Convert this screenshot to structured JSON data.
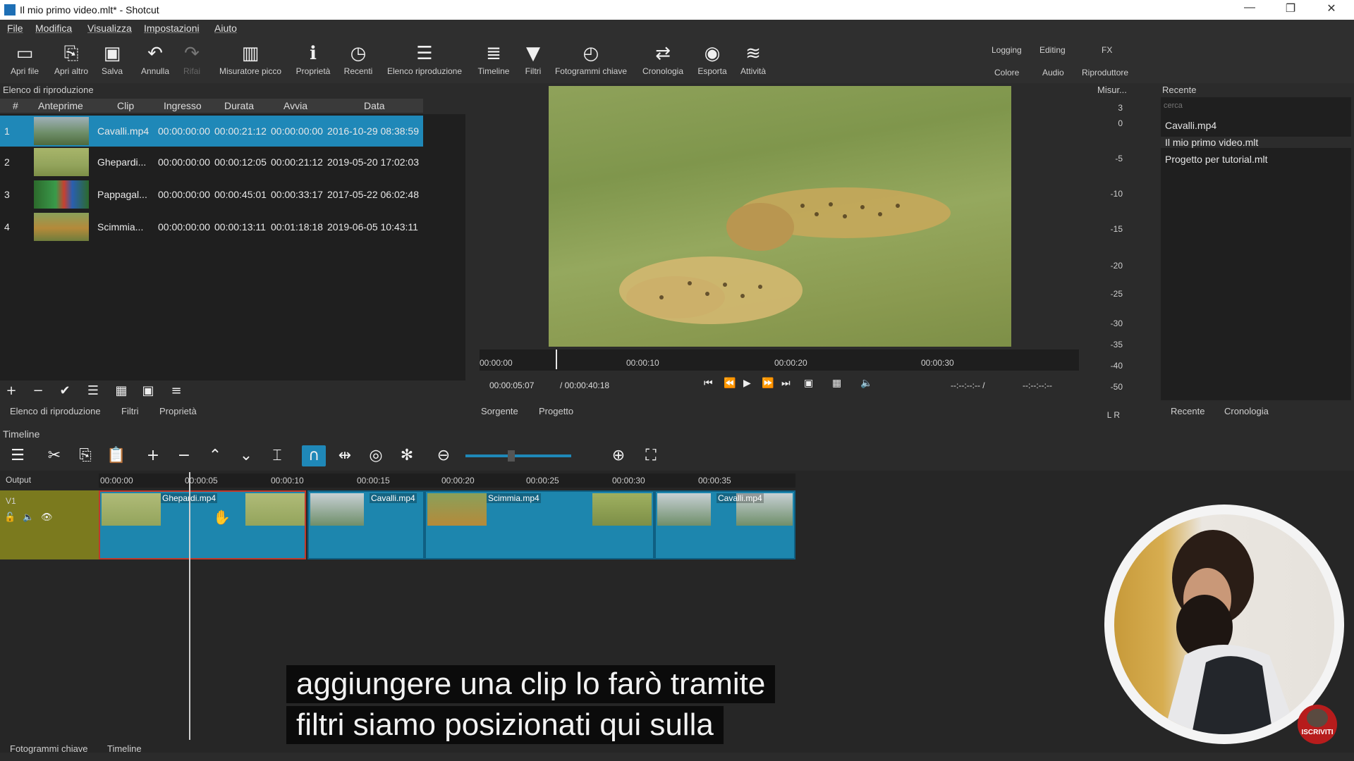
{
  "window": {
    "title": "Il mio primo video.mlt* - Shotcut"
  },
  "menu": [
    "File",
    "Modifica",
    "Visualizza",
    "Impostazioni",
    "Aiuto"
  ],
  "toolbar": [
    {
      "label": "Apri file",
      "icon": "open-folder-icon",
      "glyph": "▭"
    },
    {
      "label": "Apri altro",
      "icon": "open-other-icon",
      "glyph": "⎘"
    },
    {
      "label": "Salva",
      "icon": "save-icon",
      "glyph": "▣"
    },
    {
      "label": "Annulla",
      "icon": "undo-icon",
      "glyph": "↶"
    },
    {
      "label": "Rifai",
      "icon": "redo-icon",
      "glyph": "↷"
    },
    {
      "label": "Misuratore picco",
      "icon": "peak-meter-icon",
      "glyph": "▥"
    },
    {
      "label": "Proprietà",
      "icon": "info-icon",
      "glyph": "ℹ"
    },
    {
      "label": "Recenti",
      "icon": "clock-icon",
      "glyph": "◷"
    },
    {
      "label": "Elenco riproduzione",
      "icon": "playlist-icon",
      "glyph": "☰"
    },
    {
      "label": "Timeline",
      "icon": "timeline-icon",
      "glyph": "≣"
    },
    {
      "label": "Filtri",
      "icon": "filter-icon",
      "glyph": "▼"
    },
    {
      "label": "Fotogrammi chiave",
      "icon": "stopwatch-icon",
      "glyph": "◴"
    },
    {
      "label": "Cronologia",
      "icon": "history-icon",
      "glyph": "⇄"
    },
    {
      "label": "Esporta",
      "icon": "export-icon",
      "glyph": "◉"
    },
    {
      "label": "Attività",
      "icon": "jobs-icon",
      "glyph": "≋"
    }
  ],
  "layouts": [
    "Logging",
    "Editing",
    "FX",
    "Colore",
    "Audio",
    "Riproduttore"
  ],
  "playlist": {
    "title": "Elenco di riproduzione",
    "columns": [
      "#",
      "Anteprime",
      "Clip",
      "Ingresso",
      "Durata",
      "Avvia",
      "Data"
    ],
    "rows": [
      {
        "n": "1",
        "clip": "Cavalli.mp4",
        "in": "00:00:00:00",
        "dur": "00:00:21:12",
        "start": "00:00:00:00",
        "date": "2016-10-29 08:38:59",
        "selected": true,
        "thumb": "#6f8f6a"
      },
      {
        "n": "2",
        "clip": "Ghepardi...",
        "in": "00:00:00:00",
        "dur": "00:00:12:05",
        "start": "00:00:21:12",
        "date": "2019-05-20 17:02:03",
        "selected": false,
        "thumb": "#93a45c"
      },
      {
        "n": "3",
        "clip": "Pappagal...",
        "in": "00:00:00:00",
        "dur": "00:00:45:01",
        "start": "00:00:33:17",
        "date": "2017-05-22 06:02:48",
        "selected": false,
        "thumb": "#3a9a4a"
      },
      {
        "n": "4",
        "clip": "Scimmia...",
        "in": "00:00:00:00",
        "dur": "00:00:13:11",
        "start": "00:01:18:18",
        "date": "2019-06-05 10:43:11",
        "selected": false,
        "thumb": "#b58a3a"
      }
    ],
    "tabs": [
      "Elenco di riproduzione",
      "Filtri",
      "Proprietà"
    ]
  },
  "viewer": {
    "ruler": [
      "00:00:00",
      "00:00:10",
      "00:00:20",
      "00:00:30"
    ],
    "position": "00:00:05:07",
    "duration": "/ 00:00:40:18",
    "in_point": "--:--:--:-- /",
    "out_point": "--:--:--:--",
    "tabs": [
      "Sorgente",
      "Progetto"
    ]
  },
  "meter": {
    "title": "Misur...",
    "levels": [
      "3",
      "0",
      "-5",
      "-10",
      "-15",
      "-20",
      "-25",
      "-30",
      "-35",
      "-40",
      "-50"
    ],
    "channels": "L R"
  },
  "recent": {
    "title": "Recente",
    "search_placeholder": "cerca",
    "items": [
      "Cavalli.mp4",
      "Il mio primo video.mlt",
      "Progetto per tutorial.mlt"
    ],
    "tabs": [
      "Recente",
      "Cronologia"
    ]
  },
  "timeline": {
    "title": "Timeline",
    "output_label": "Output",
    "track_label": "V1",
    "ruler": [
      "00:00:00",
      "00:00:05",
      "00:00:10",
      "00:00:15",
      "00:00:20",
      "00:00:25",
      "00:00:30",
      "00:00:35"
    ],
    "clips": [
      "Ghepardi.mp4",
      "Cavalli.mp4",
      "Scimmia.mp4",
      "Cavalli.mp4"
    ]
  },
  "bottom_tabs": [
    "Fotogrammi chiave",
    "Timeline"
  ],
  "subtitles": [
    "aggiungere una clip lo farò tramite",
    "filtri siamo posizionati qui sulla"
  ],
  "overlay": {
    "subscribe_label": "ISCRIVITI"
  }
}
